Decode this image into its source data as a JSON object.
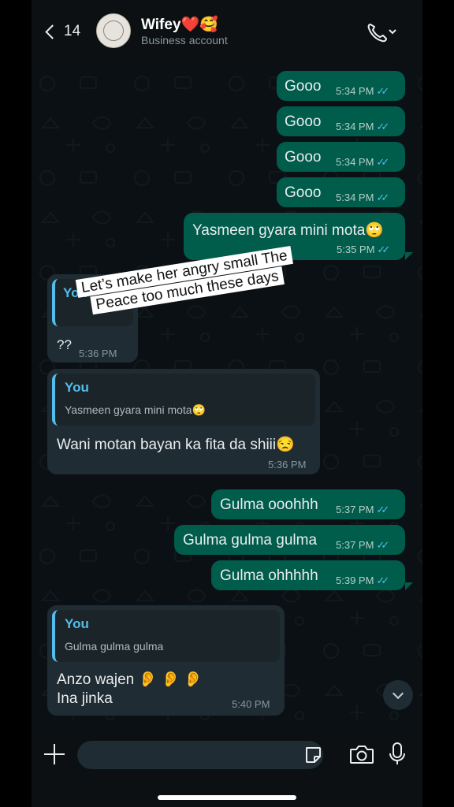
{
  "header": {
    "back_count": "14",
    "contact_name": "Wifey❤️🥰",
    "contact_subtitle": "Business account"
  },
  "messages": [
    {
      "direction": "out",
      "text": "Gooo",
      "time": "5:34 PM"
    },
    {
      "direction": "out",
      "text": "Gooo",
      "time": "5:34 PM"
    },
    {
      "direction": "out",
      "text": "Gooo",
      "time": "5:34 PM"
    },
    {
      "direction": "out",
      "text": "Gooo",
      "time": "5:34 PM"
    },
    {
      "direction": "out",
      "text": "Yasmeen gyara mini mota🙄",
      "time": "5:35 PM"
    },
    {
      "direction": "in",
      "quote_name": "You",
      "text": "??",
      "time": "5:36 PM"
    },
    {
      "direction": "in",
      "quote_name": "You",
      "quote_text": "Yasmeen gyara mini mota🙄",
      "text": "Wani motan bayan ka fita da shiii😒",
      "time": "5:36 PM"
    },
    {
      "direction": "out",
      "text": "Gulma ooohhh",
      "time": "5:37 PM"
    },
    {
      "direction": "out",
      "text": "Gulma gulma gulma",
      "time": "5:37 PM"
    },
    {
      "direction": "out",
      "text": "Gulma ohhhhh",
      "time": "5:39 PM"
    },
    {
      "direction": "in",
      "quote_name": "You",
      "quote_text": "Gulma gulma gulma",
      "text_line1": "Anzo wajen 👂 👂 👂",
      "text_line2": "Ina jinka",
      "time": "5:40 PM"
    }
  ],
  "overlay_caption": "Let’s make her angry small The Peace too much these days",
  "input": {
    "placeholder": ""
  },
  "colors": {
    "outgoing_bubble": "#005c4b",
    "incoming_bubble": "#1f2c33",
    "read_ticks": "#53bdeb",
    "quote_accent": "#53bdeb"
  },
  "icons": [
    "back-chevron-icon",
    "phone-call-icon",
    "chevron-down-icon",
    "plus-icon",
    "sticker-icon",
    "camera-icon",
    "microphone-icon",
    "double-check-icon"
  ]
}
